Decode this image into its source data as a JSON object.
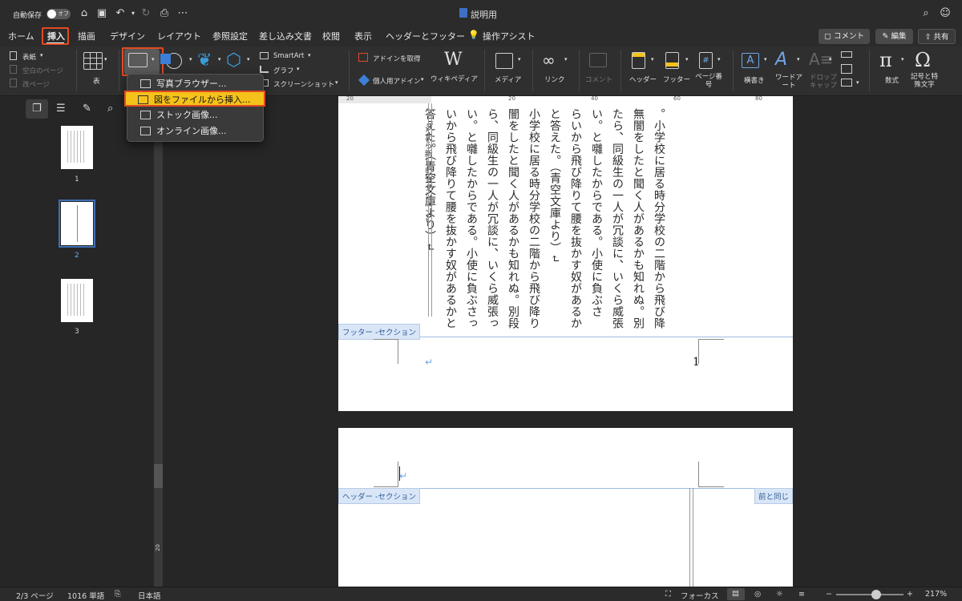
{
  "titlebar": {
    "autosave_label": "自動保存",
    "autosave_state": "オフ",
    "doc_title": "説明用",
    "more": "⋯"
  },
  "tabs": {
    "items": [
      "ホーム",
      "挿入",
      "描画",
      "デザイン",
      "レイアウト",
      "参照設定",
      "差し込み文書",
      "校閲",
      "表示",
      "ヘッダーとフッター",
      "操作アシスト"
    ],
    "active": "挿入",
    "comment_label": "コメント",
    "edit_label": "編集",
    "share_label": "共有"
  },
  "ribbon": {
    "cover_label": "表紙",
    "blank_page_label": "空白のページ",
    "page_break_label": "改ページ",
    "table_label": "表",
    "smartart_label": "SmartArt",
    "graph_label": "グラフ",
    "screenshot_label": "スクリーンショット",
    "get_addins_label": "アドインを取得",
    "my_addins_label": "個人用アドイン",
    "wikipedia_label": "ウィキペディア",
    "wikipedia_glyph": "W",
    "media_label": "メディア",
    "link_label": "リンク",
    "comment_label": "コメント",
    "header_label": "ヘッダー",
    "footer_label": "フッター",
    "page_number_label": "ページ番号",
    "textbox_label": "横書き",
    "wordart_label": "ワードアート",
    "dropcap_label": "ドロップキャップ",
    "equation_label": "数式",
    "symbol_label": "記号と特殊文字"
  },
  "dropdown": {
    "items": [
      {
        "label": "写真ブラウザー..."
      },
      {
        "label": "図をファイルから挿入..."
      },
      {
        "label": "ストック画像..."
      },
      {
        "label": "オンライン画像..."
      }
    ],
    "highlighted_index": 1
  },
  "ruler": {
    "ticks": [
      "20",
      "20",
      "40",
      "60",
      "80"
    ]
  },
  "vruler": {
    "tick": "20"
  },
  "thumbnails": [
    {
      "num": "1"
    },
    {
      "num": "2"
    },
    {
      "num": "3"
    }
  ],
  "document": {
    "columns": [
      "。小学校に居る時分学校の二階から飛び降",
      "無闇をしたと聞く人があるかも知れぬ。別",
      "たら、同級生の一人が冗談に、いくら威張",
      "い。と囃したからである。小使に負ぶさ",
      "らいから飛び降りて腰を抜かす奴があるか",
      "と答えた。（青空文庫より）↵",
      "小学校に居る時分学校の二階から飛び降り",
      "闇をしたと聞く人があるかも知れぬ。別段",
      "ら、同級生の一人が冗談に、いくら威張っ",
      "い。と囃したからである。小使に負ぶさっ",
      "いから飛び降りて腰を抜かす奴があるかと",
      "答えた。（青空文庫より）↵",
      "ジから新しいセクション↵"
    ],
    "footer_section_label": "フッター -セクション",
    "header_section_label": "ヘッダー -セクション",
    "same_as_prev_label": "前と同じ",
    "page_number": "1",
    "return_mark": "↵"
  },
  "statusbar": {
    "page": "2/3 ページ",
    "words": "1016 単語",
    "language": "日本語",
    "focus_label": "フォーカス",
    "zoom": "217%",
    "zoom_level": 0.6
  },
  "colors": {
    "accent_red": "#e24a23",
    "highlight_yellow": "#f4c21a",
    "section_blue": "#2f5d97"
  }
}
